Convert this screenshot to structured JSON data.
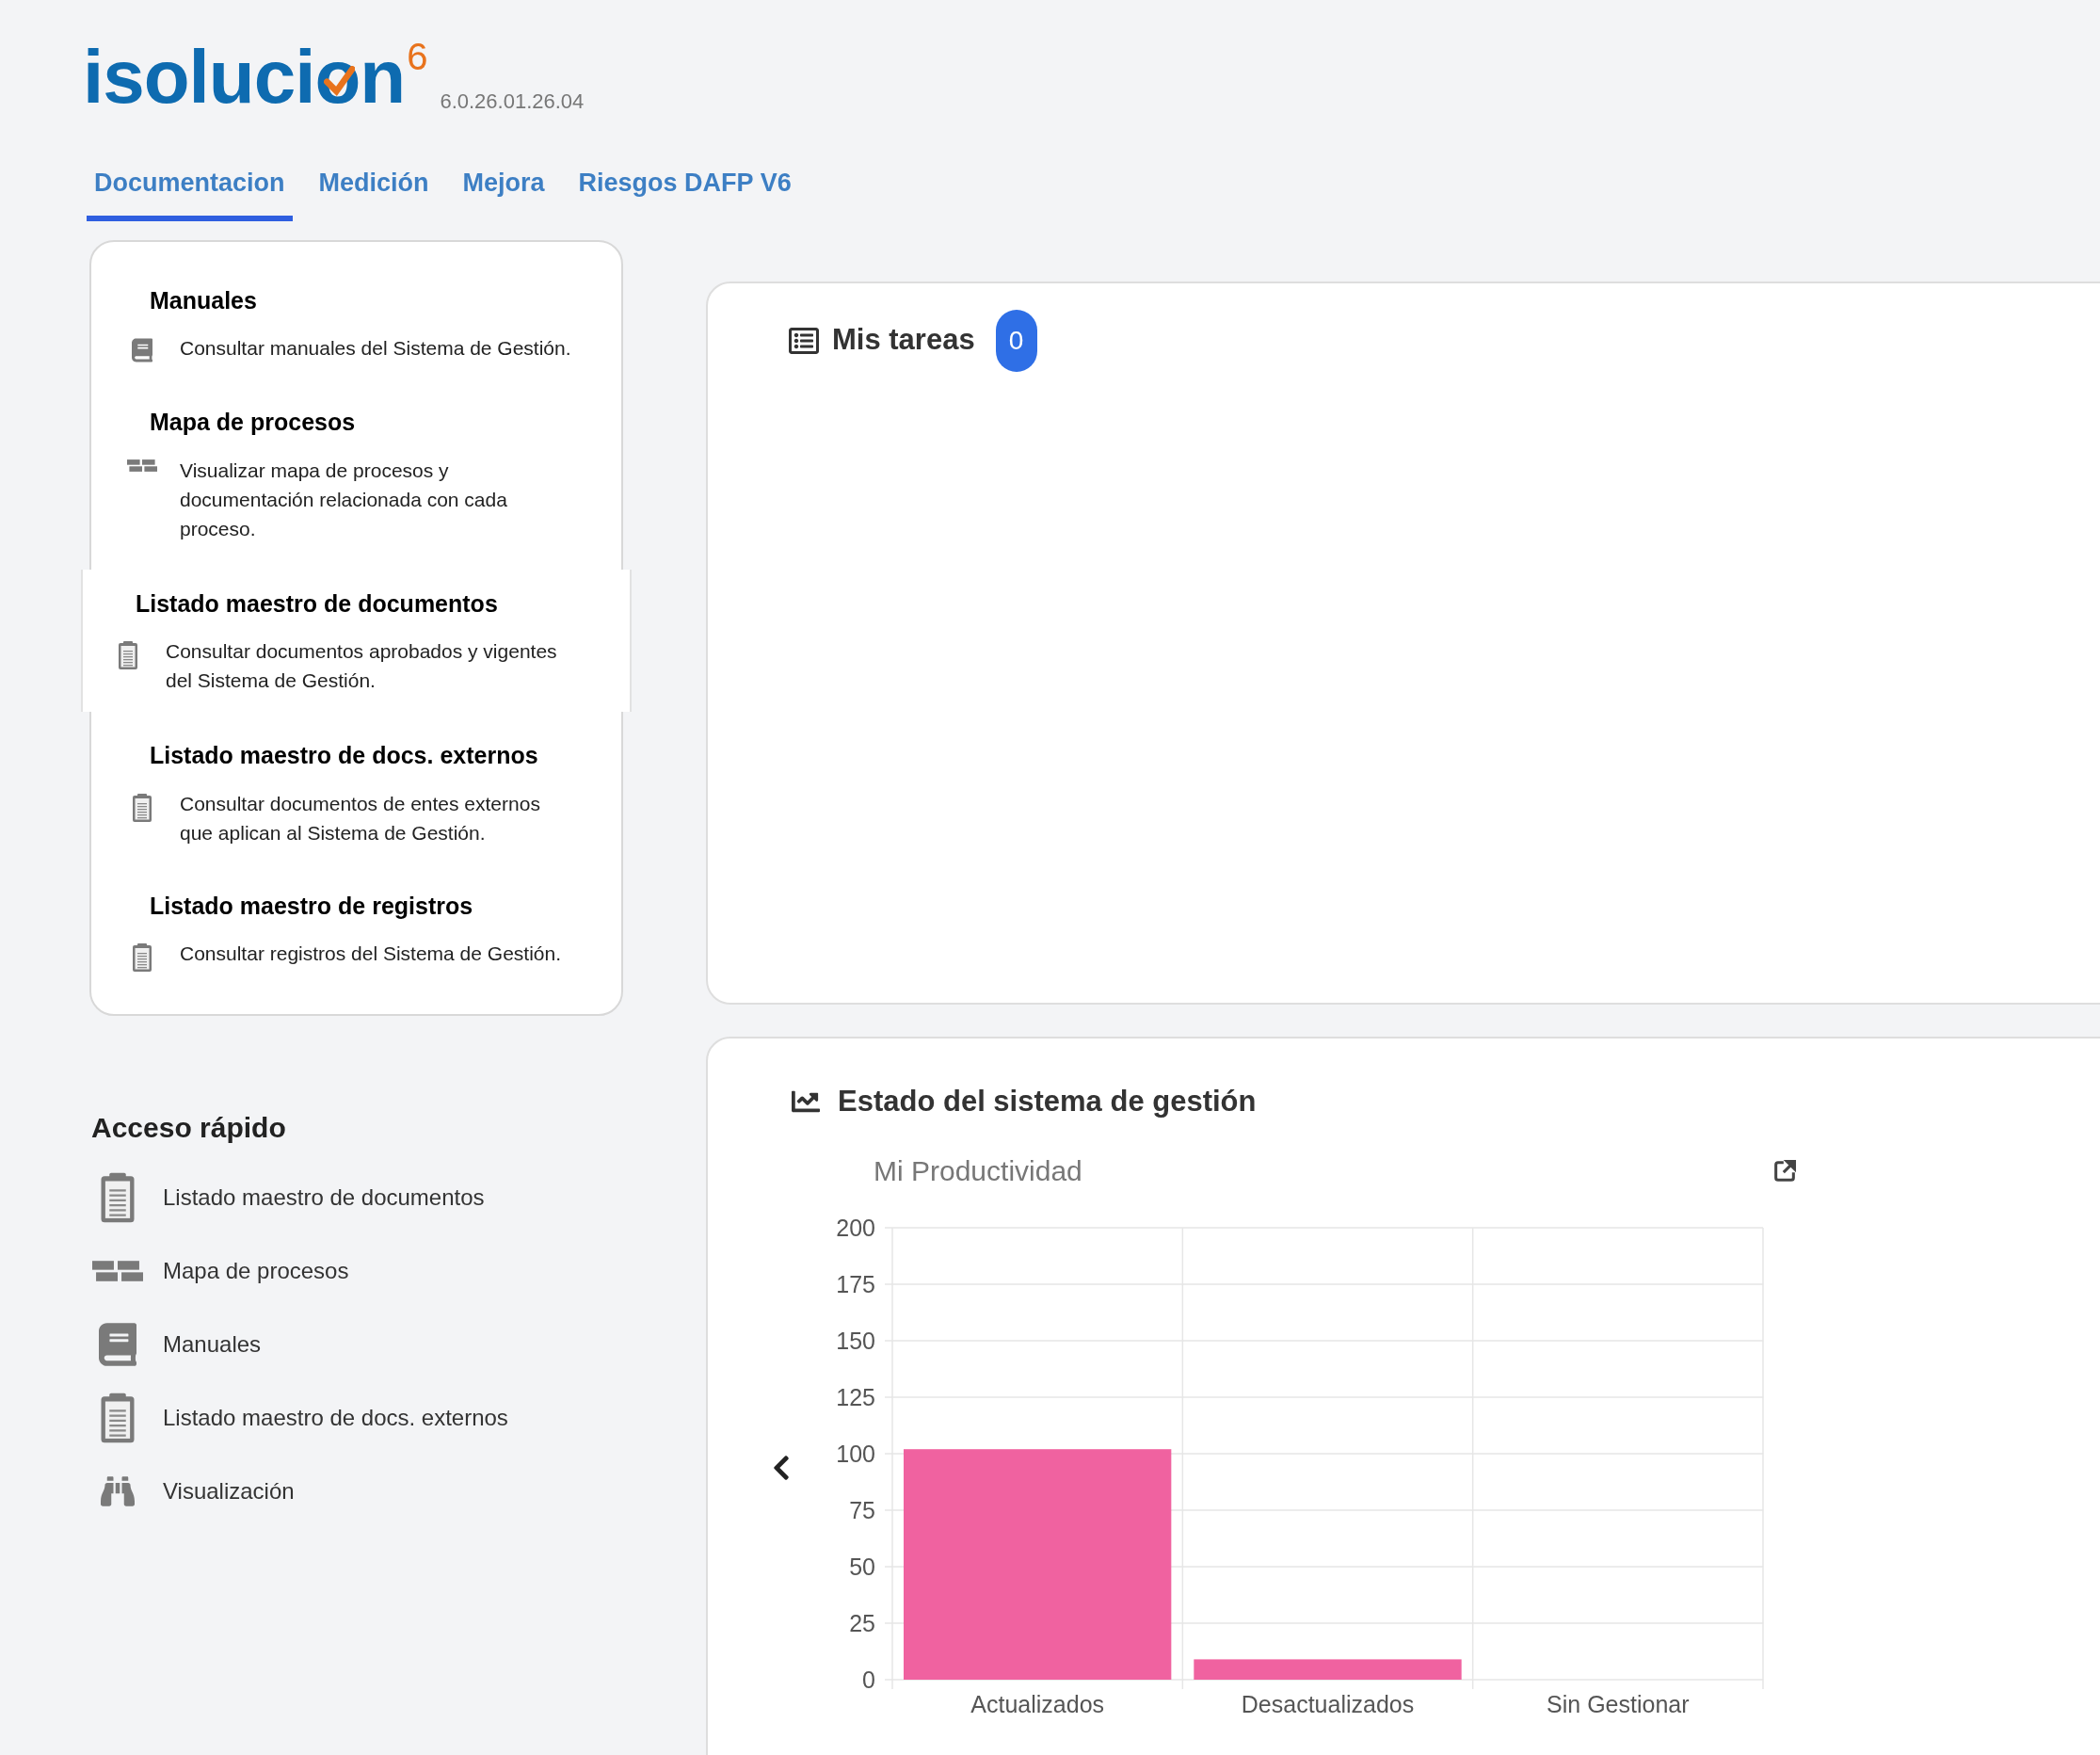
{
  "logo": {
    "text": "isolucion",
    "superscript": "6",
    "version": "6.0.26.01.26.04"
  },
  "tabs": [
    {
      "label": "Documentacion",
      "selected": true
    },
    {
      "label": "Medición",
      "selected": false
    },
    {
      "label": "Mejora",
      "selected": false
    },
    {
      "label": "Riesgos DAFP V6",
      "selected": false
    }
  ],
  "menu": [
    {
      "title": "Manuales",
      "description": "Consultar manuales del Sistema de Gestión.",
      "kind": "book",
      "selected": false
    },
    {
      "title": "Mapa de procesos",
      "description": "Visualizar mapa de procesos y documentación relacionada con cada proceso.",
      "kind": "map",
      "selected": false
    },
    {
      "title": "Listado maestro de documentos",
      "description": "Consultar documentos aprobados y vigentes del Sistema de Gestión.",
      "kind": "clipboard",
      "selected": true
    },
    {
      "title": "Listado maestro de docs. externos",
      "description": "Consultar documentos de entes externos que aplican al Sistema de Gestión.",
      "kind": "clipboard",
      "selected": false
    },
    {
      "title": "Listado maestro de registros",
      "description": "Consultar registros del Sistema de Gestión.",
      "kind": "clipboard",
      "selected": false
    }
  ],
  "quick_access": {
    "title": "Acceso rápido",
    "items": [
      {
        "label": "Listado maestro de documentos",
        "kind": "clipboard"
      },
      {
        "label": "Mapa de procesos",
        "kind": "map"
      },
      {
        "label": "Manuales",
        "kind": "book"
      },
      {
        "label": "Listado maestro de docs. externos",
        "kind": "clipboard"
      },
      {
        "label": "Visualización",
        "kind": "binoculars"
      }
    ]
  },
  "tasks": {
    "title": "Mis tareas",
    "count": "0"
  },
  "status": {
    "title": "Estado del sistema de gestión",
    "chart_data": {
      "type": "bar",
      "categories": [
        "Actualizados",
        "Desactualizados",
        "Sin Gestionar"
      ],
      "series": [
        {
          "name": "Mi Productividad",
          "color": "#f062a0",
          "values": [
            102,
            9,
            0
          ]
        }
      ],
      "ylim": [
        0,
        200
      ],
      "grid": true,
      "yticks": [
        0,
        25,
        50,
        75,
        100,
        125,
        150,
        175,
        200
      ]
    }
  }
}
